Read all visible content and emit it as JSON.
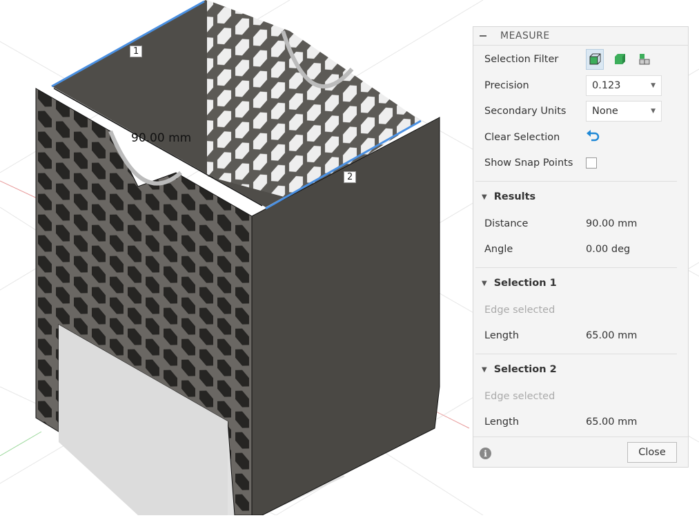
{
  "viewport": {
    "edge_labels": [
      "1",
      "2"
    ],
    "dimension": "90.00 mm",
    "model_color": "#4a4844",
    "highlight_color": "#4a90e2"
  },
  "panel": {
    "title": "MEASURE",
    "selection_filter": {
      "label": "Selection Filter",
      "icons": [
        "select-through-icon",
        "body-select-icon",
        "component-select-icon"
      ],
      "active": 0
    },
    "precision": {
      "label": "Precision",
      "value": "0.123"
    },
    "secondary_units": {
      "label": "Secondary Units",
      "value": "None"
    },
    "clear_selection": {
      "label": "Clear Selection",
      "icon": "undo-icon"
    },
    "snap": {
      "label": "Show Snap Points",
      "checked": false
    },
    "results": {
      "title": "Results",
      "distance_label": "Distance",
      "distance": "90.00 mm",
      "angle_label": "Angle",
      "angle": "0.00 deg"
    },
    "selection1": {
      "title": "Selection 1",
      "status": "Edge selected",
      "length_label": "Length",
      "length": "65.00 mm"
    },
    "selection2": {
      "title": "Selection 2",
      "status": "Edge selected",
      "length_label": "Length",
      "length": "65.00 mm"
    },
    "close_label": "Close"
  }
}
